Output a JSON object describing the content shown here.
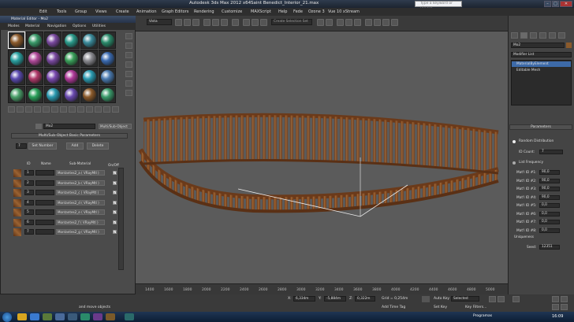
{
  "window": {
    "app_title": "Autodesk 3ds Max  2012 x64",
    "file_title": "Saint Benedict_Interior_21.max",
    "search_placeholder": "Type a keyword or phrase"
  },
  "menus": [
    "Edit",
    "Tools",
    "Group",
    "Views",
    "Create",
    "Modifiers",
    "Animation",
    "Graph Editors",
    "Rendering",
    "Customize",
    "MAXScript",
    "Help",
    "Fede",
    "Ozone 3",
    "Vue 10 xStream"
  ],
  "toolbar": {
    "selection_filter": "Vista",
    "selection_set": "Create Selection Set"
  },
  "material_editor": {
    "title": "Material Editor - Mo2",
    "menus": [
      "Modes",
      "Material",
      "Navigation",
      "Options",
      "Utilities"
    ],
    "sphere_colors": [
      "#8b5a2b",
      "#3a9a6a",
      "#7a4aa0",
      "#2a9a8a",
      "#3a8a9a",
      "#2a8a6a",
      "#2aa0a0",
      "#b04a9a",
      "#7a4aa0",
      "#3aa05a",
      "#8a8a90",
      "#3a6ab0",
      "#5a4ab0",
      "#b03a6a",
      "#7a4ab0",
      "#b03a9a",
      "#2a9ab0",
      "#4a7ab0",
      "#4aa06a",
      "#2aa05a",
      "#2a9ab0",
      "#6a4ab0"
    ],
    "material_name": "Mo2",
    "material_type": "Multi/Sub-Object",
    "rollout_title": "Multi/Sub-Object Basic Parameters",
    "count": "7",
    "set_number": "Set Number",
    "add": "Add",
    "delete": "Delete",
    "col_id": "ID",
    "col_name": "Name",
    "col_sub": "Sub-Material",
    "col_onoff": "On/Off",
    "rows": [
      {
        "id": "1",
        "sub": "Montantes2_a  ( VRayMtl )"
      },
      {
        "id": "2",
        "sub": "Montantes2_b  ( VRayMtl )"
      },
      {
        "id": "3",
        "sub": "Montantes2_c  ( VRayMtl )"
      },
      {
        "id": "4",
        "sub": "Montantes2_d  ( VRayMtl )"
      },
      {
        "id": "5",
        "sub": "Montantes2_e  ( VRayMtl )"
      },
      {
        "id": "6",
        "sub": "Montantes2_f  ( VRayMtl )"
      },
      {
        "id": "7",
        "sub": "Montantes2_g  ( VRayMtl )"
      }
    ]
  },
  "command_panel": {
    "object_name": "Mo2",
    "modifier_list": "Modifier List",
    "stack": [
      "MaterialByElement",
      "Editable Mesh"
    ],
    "params_title": "Parameters",
    "random_dist": "Random Distribution",
    "id_count_label": "ID Count:",
    "id_count": "7",
    "list_freq": "List Frequency",
    "ids": [
      {
        "label": "Mat'l ID #1:",
        "val": "90,0"
      },
      {
        "label": "Mat'l ID #2:",
        "val": "90,0"
      },
      {
        "label": "Mat'l ID #3:",
        "val": "90,0"
      },
      {
        "label": "Mat'l ID #4:",
        "val": "90,0"
      },
      {
        "label": "Mat'l ID #5:",
        "val": "0,0"
      },
      {
        "label": "Mat'l ID #6:",
        "val": "0,0"
      },
      {
        "label": "Mat'l ID #7:",
        "val": "0,0"
      },
      {
        "label": "Mat'l ID #8:",
        "val": "0,0"
      }
    ],
    "uniqueness": "Uniqueness",
    "seed_label": "Seed:",
    "seed": "12351"
  },
  "timeline": {
    "ticks": [
      "1400",
      "1500",
      "1600",
      "1700",
      "1800",
      "1900",
      "2000",
      "2100",
      "2200",
      "2300",
      "2400",
      "2500",
      "2600",
      "2700",
      "2800",
      "2900",
      "3000",
      "3100",
      "3200",
      "3300",
      "3400",
      "3500",
      "3600",
      "3700",
      "3800",
      "3900",
      "4000",
      "4100",
      "4200",
      "4300",
      "4400",
      "4500",
      "4600",
      "4700",
      "4800",
      "4900",
      "5000"
    ]
  },
  "status": {
    "x": "6,334m",
    "y": "-5,884m",
    "z": "0,322m",
    "grid": "Grid = 0,254m",
    "auto_key": "Auto Key",
    "selected": "Selected",
    "set_key": "Set Key",
    "key_filters": "Key Filters...",
    "add_time_tag": "Add Time Tag",
    "prompt": "and move objects"
  },
  "taskbar": {
    "programs": "Programas",
    "time": "16:09"
  }
}
